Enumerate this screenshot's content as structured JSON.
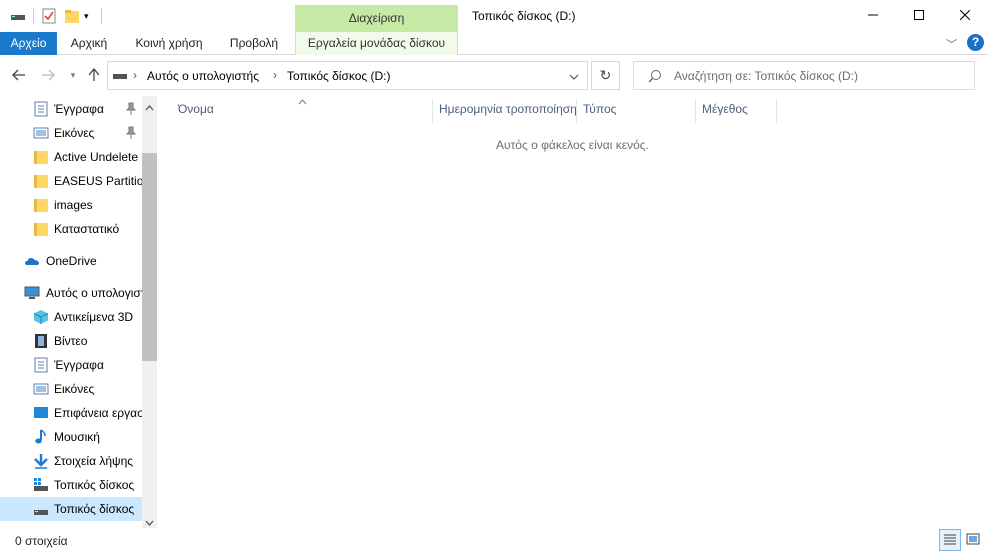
{
  "window": {
    "title": "Τοπικός δίσκος (D:)",
    "context_tab_group": "Διαχείριση"
  },
  "ribbon": {
    "tabs": [
      "Αρχείο",
      "Αρχική",
      "Κοινή χρήση",
      "Προβολή",
      "Εργαλεία μονάδας δίσκου"
    ]
  },
  "address": {
    "crumbs": [
      "Αυτός ο υπολογιστής",
      "Τοπικός δίσκος (D:)"
    ],
    "search_placeholder": "Αναζήτηση σε: Τοπικός δίσκος (D:)"
  },
  "nav": {
    "items": [
      {
        "label": "Έγγραφα",
        "icon": "documents-icon",
        "pinned": true
      },
      {
        "label": "Εικόνες",
        "icon": "pictures-icon",
        "pinned": true
      },
      {
        "label": "Active Undelete",
        "icon": "folder-icon"
      },
      {
        "label": "EASEUS Partition",
        "icon": "folder-icon"
      },
      {
        "label": "images",
        "icon": "folder-icon"
      },
      {
        "label": "Καταστατικό",
        "icon": "folder-icon"
      },
      {
        "label": "OneDrive",
        "icon": "onedrive-icon"
      },
      {
        "label": "Αυτός ο υπολογιστής",
        "icon": "this-pc-icon"
      },
      {
        "label": "Αντικείμενα 3D",
        "icon": "3d-objects-icon"
      },
      {
        "label": "Βίντεο",
        "icon": "videos-icon"
      },
      {
        "label": "Έγγραφα",
        "icon": "documents-icon"
      },
      {
        "label": "Εικόνες",
        "icon": "pictures-icon"
      },
      {
        "label": "Επιφάνεια εργασίας",
        "icon": "desktop-icon"
      },
      {
        "label": "Μουσική",
        "icon": "music-icon"
      },
      {
        "label": "Στοιχεία λήψης",
        "icon": "downloads-icon"
      },
      {
        "label": "Τοπικός δίσκος",
        "icon": "drive-icon"
      },
      {
        "label": "Τοπικός δίσκος",
        "icon": "drive-icon",
        "selected": true
      }
    ]
  },
  "content": {
    "columns": [
      "Όνομα",
      "Ημερομηνία τροποποίησης",
      "Τύπος",
      "Μέγεθος"
    ],
    "empty_message": "Αυτός ο φάκελος είναι κενός."
  },
  "status": {
    "item_count": "0 στοιχεία"
  },
  "colors": {
    "accent": "#1979ca",
    "context_tab": "#c6e9a6",
    "selection": "#cce8ff"
  }
}
